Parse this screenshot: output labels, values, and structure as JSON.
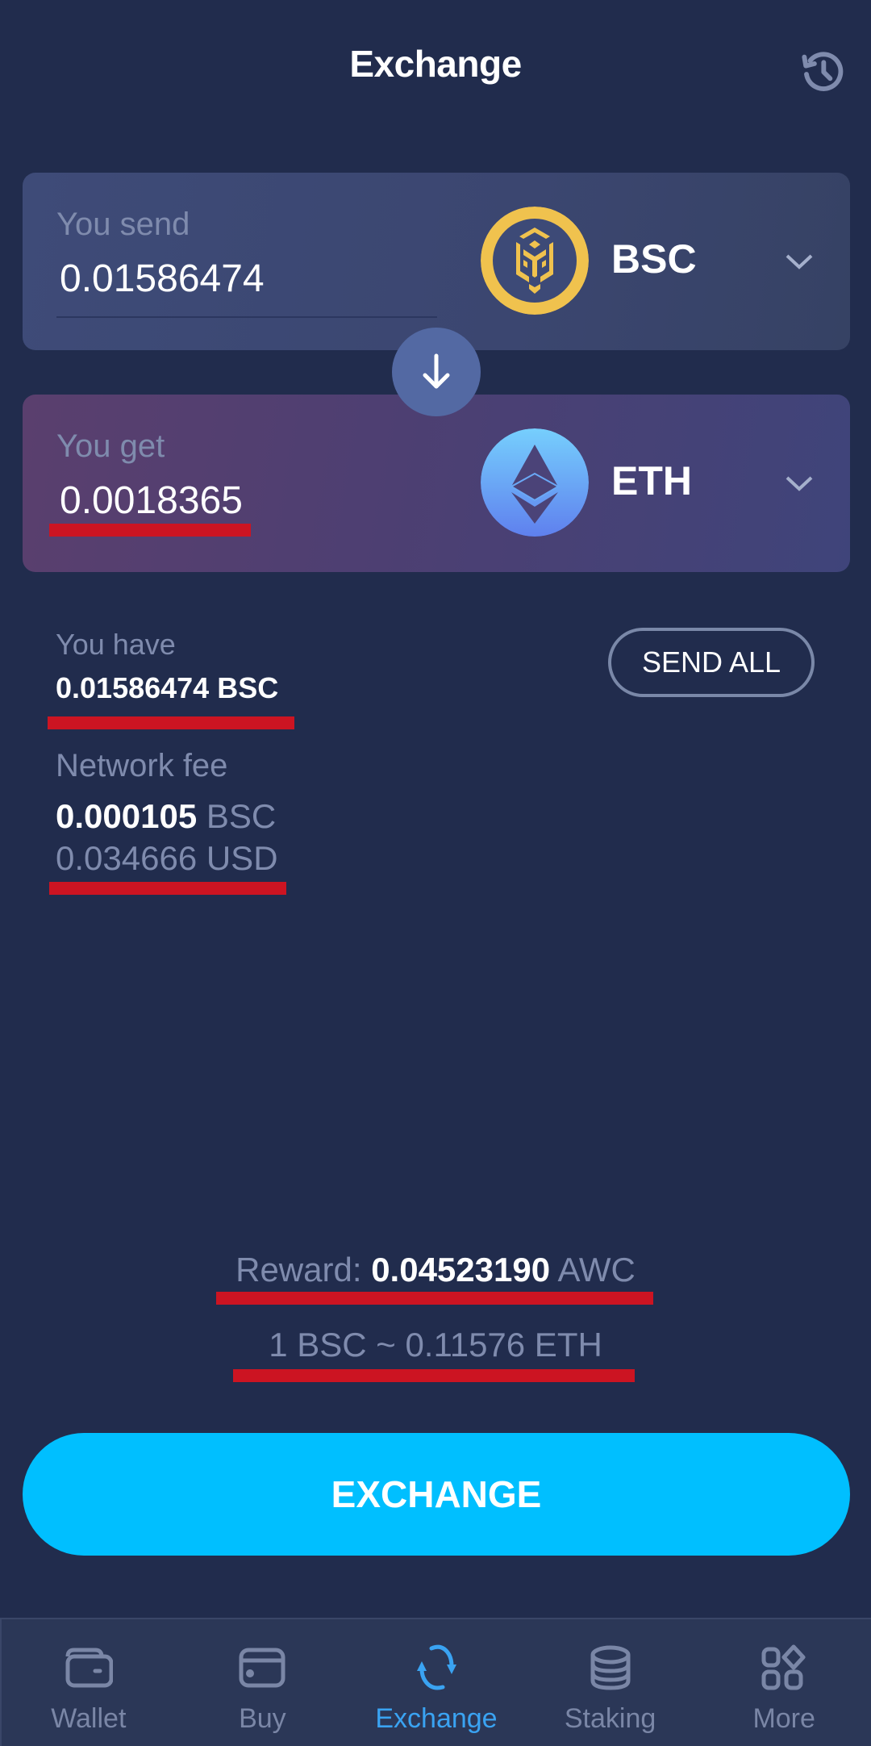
{
  "header": {
    "title": "Exchange",
    "history_icon": "history-icon"
  },
  "send": {
    "label": "You send",
    "value": "0.01586474",
    "coin": "BSC",
    "coin_icon": "bnb-coin-icon",
    "coin_color": "#f0c24e"
  },
  "swap": {
    "icon": "arrow-down-icon"
  },
  "get": {
    "label": "You get",
    "value": "0.0018365",
    "coin": "ETH",
    "coin_icon": "eth-coin-icon",
    "coin_color": "#6aa8f6"
  },
  "balance": {
    "label": "You have",
    "value": "0.01586474 BSC",
    "send_all_label": "SEND ALL"
  },
  "fee": {
    "label": "Network fee",
    "amount": "0.000105",
    "amount_unit": "BSC",
    "usd": "0.034666 USD"
  },
  "reward": {
    "label": "Reward:",
    "amount": "0.04523190",
    "unit": "AWC"
  },
  "rate": "1 BSC ~ 0.11576 ETH",
  "exchange_button": "EXCHANGE",
  "nav": {
    "items": [
      {
        "label": "Wallet",
        "icon": "wallet-icon",
        "active": false
      },
      {
        "label": "Buy",
        "icon": "card-icon",
        "active": false
      },
      {
        "label": "Exchange",
        "icon": "exchange-icon",
        "active": true
      },
      {
        "label": "Staking",
        "icon": "coins-stack-icon",
        "active": false
      },
      {
        "label": "More",
        "icon": "grid-more-icon",
        "active": false
      }
    ]
  },
  "colors": {
    "background": "#212c4d",
    "accent": "#00bfff",
    "active_nav": "#3aa3f2",
    "muted_text": "#7f8bad",
    "annotation_red": "#cc1422"
  }
}
